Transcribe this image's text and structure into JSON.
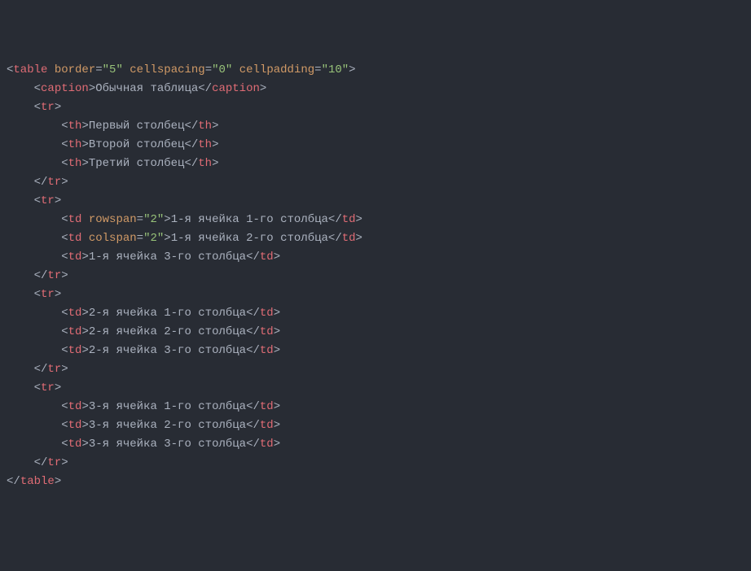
{
  "lines": [
    {
      "indent": 0,
      "parts": [
        {
          "t": "open",
          "tag": "table",
          "attrs": [
            {
              "n": "border",
              "v": "5"
            },
            {
              "n": "cellspacing",
              "v": "0"
            },
            {
              "n": "cellpadding",
              "v": "10"
            }
          ]
        }
      ]
    },
    {
      "indent": 1,
      "parts": [
        {
          "t": "open",
          "tag": "caption"
        },
        {
          "t": "text",
          "v": "Обычная таблица"
        },
        {
          "t": "close",
          "tag": "caption"
        }
      ]
    },
    {
      "indent": 1,
      "parts": [
        {
          "t": "open",
          "tag": "tr"
        }
      ]
    },
    {
      "indent": 2,
      "parts": [
        {
          "t": "open",
          "tag": "th"
        },
        {
          "t": "text",
          "v": "Первый столбец"
        },
        {
          "t": "close",
          "tag": "th"
        }
      ]
    },
    {
      "indent": 2,
      "parts": [
        {
          "t": "open",
          "tag": "th"
        },
        {
          "t": "text",
          "v": "Второй столбец"
        },
        {
          "t": "close",
          "tag": "th"
        }
      ]
    },
    {
      "indent": 2,
      "parts": [
        {
          "t": "open",
          "tag": "th"
        },
        {
          "t": "text",
          "v": "Третий столбец"
        },
        {
          "t": "close",
          "tag": "th"
        }
      ]
    },
    {
      "indent": 1,
      "parts": [
        {
          "t": "close",
          "tag": "tr"
        }
      ]
    },
    {
      "indent": 1,
      "parts": [
        {
          "t": "open",
          "tag": "tr"
        }
      ]
    },
    {
      "indent": 2,
      "parts": [
        {
          "t": "open",
          "tag": "td",
          "attrs": [
            {
              "n": "rowspan",
              "v": "2"
            }
          ]
        },
        {
          "t": "text",
          "v": "1-я ячейка 1-го столбца"
        },
        {
          "t": "close",
          "tag": "td"
        }
      ]
    },
    {
      "indent": 2,
      "parts": [
        {
          "t": "open",
          "tag": "td",
          "attrs": [
            {
              "n": "colspan",
              "v": "2"
            }
          ]
        },
        {
          "t": "text",
          "v": "1-я ячейка 2-го столбца"
        },
        {
          "t": "close",
          "tag": "td"
        }
      ]
    },
    {
      "indent": 2,
      "parts": [
        {
          "t": "open",
          "tag": "td"
        },
        {
          "t": "text",
          "v": "1-я ячейка 3-го столбца"
        },
        {
          "t": "close",
          "tag": "td"
        }
      ]
    },
    {
      "indent": 1,
      "parts": [
        {
          "t": "close",
          "tag": "tr"
        }
      ]
    },
    {
      "indent": 1,
      "parts": [
        {
          "t": "open",
          "tag": "tr"
        }
      ]
    },
    {
      "indent": 2,
      "parts": [
        {
          "t": "open",
          "tag": "td"
        },
        {
          "t": "text",
          "v": "2-я ячейка 1-го столбца"
        },
        {
          "t": "close",
          "tag": "td"
        }
      ]
    },
    {
      "indent": 2,
      "parts": [
        {
          "t": "open",
          "tag": "td"
        },
        {
          "t": "text",
          "v": "2-я ячейка 2-го столбца"
        },
        {
          "t": "close",
          "tag": "td"
        }
      ]
    },
    {
      "indent": 2,
      "parts": [
        {
          "t": "open",
          "tag": "td"
        },
        {
          "t": "text",
          "v": "2-я ячейка 3-го столбца"
        },
        {
          "t": "close",
          "tag": "td"
        }
      ]
    },
    {
      "indent": 1,
      "parts": [
        {
          "t": "close",
          "tag": "tr"
        }
      ]
    },
    {
      "indent": 1,
      "parts": [
        {
          "t": "open",
          "tag": "tr"
        }
      ]
    },
    {
      "indent": 2,
      "parts": [
        {
          "t": "open",
          "tag": "td"
        },
        {
          "t": "text",
          "v": "3-я ячейка 1-го столбца"
        },
        {
          "t": "close",
          "tag": "td"
        }
      ]
    },
    {
      "indent": 2,
      "parts": [
        {
          "t": "open",
          "tag": "td"
        },
        {
          "t": "text",
          "v": "3-я ячейка 2-го столбца"
        },
        {
          "t": "close",
          "tag": "td"
        }
      ]
    },
    {
      "indent": 2,
      "parts": [
        {
          "t": "open",
          "tag": "td"
        },
        {
          "t": "text",
          "v": "3-я ячейка 3-го столбца"
        },
        {
          "t": "close",
          "tag": "td"
        }
      ]
    },
    {
      "indent": 1,
      "parts": [
        {
          "t": "close",
          "tag": "tr"
        }
      ]
    },
    {
      "indent": 0,
      "parts": [
        {
          "t": "close",
          "tag": "table"
        }
      ]
    }
  ],
  "indentUnit": "    "
}
